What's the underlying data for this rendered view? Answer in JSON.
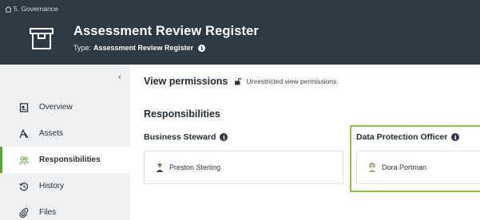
{
  "breadcrumb": {
    "label": "5. Governance"
  },
  "header": {
    "title": "Assessment Review Register",
    "type_prefix": "Type:",
    "type_value": "Assessment Review Register"
  },
  "sidebar": {
    "collapse_glyph": "‹",
    "items": [
      {
        "label": "Overview"
      },
      {
        "label": "Assets"
      },
      {
        "label": "Responsibilities",
        "active": true
      },
      {
        "label": "History"
      },
      {
        "label": "Files"
      }
    ]
  },
  "main": {
    "view_permissions_title": "View permissions",
    "view_permissions_text": "Unrestricted view permissions.",
    "responsibilities_title": "Responsibilities",
    "roles": [
      {
        "name": "Business Steward",
        "user": "Preston Sterling"
      },
      {
        "name": "Data Protection Officer",
        "user": "Dora Portman"
      }
    ]
  },
  "colors": {
    "header_bg": "#2e3a43",
    "accent_green": "#5aa33a",
    "highlight": "#8cc63f"
  }
}
